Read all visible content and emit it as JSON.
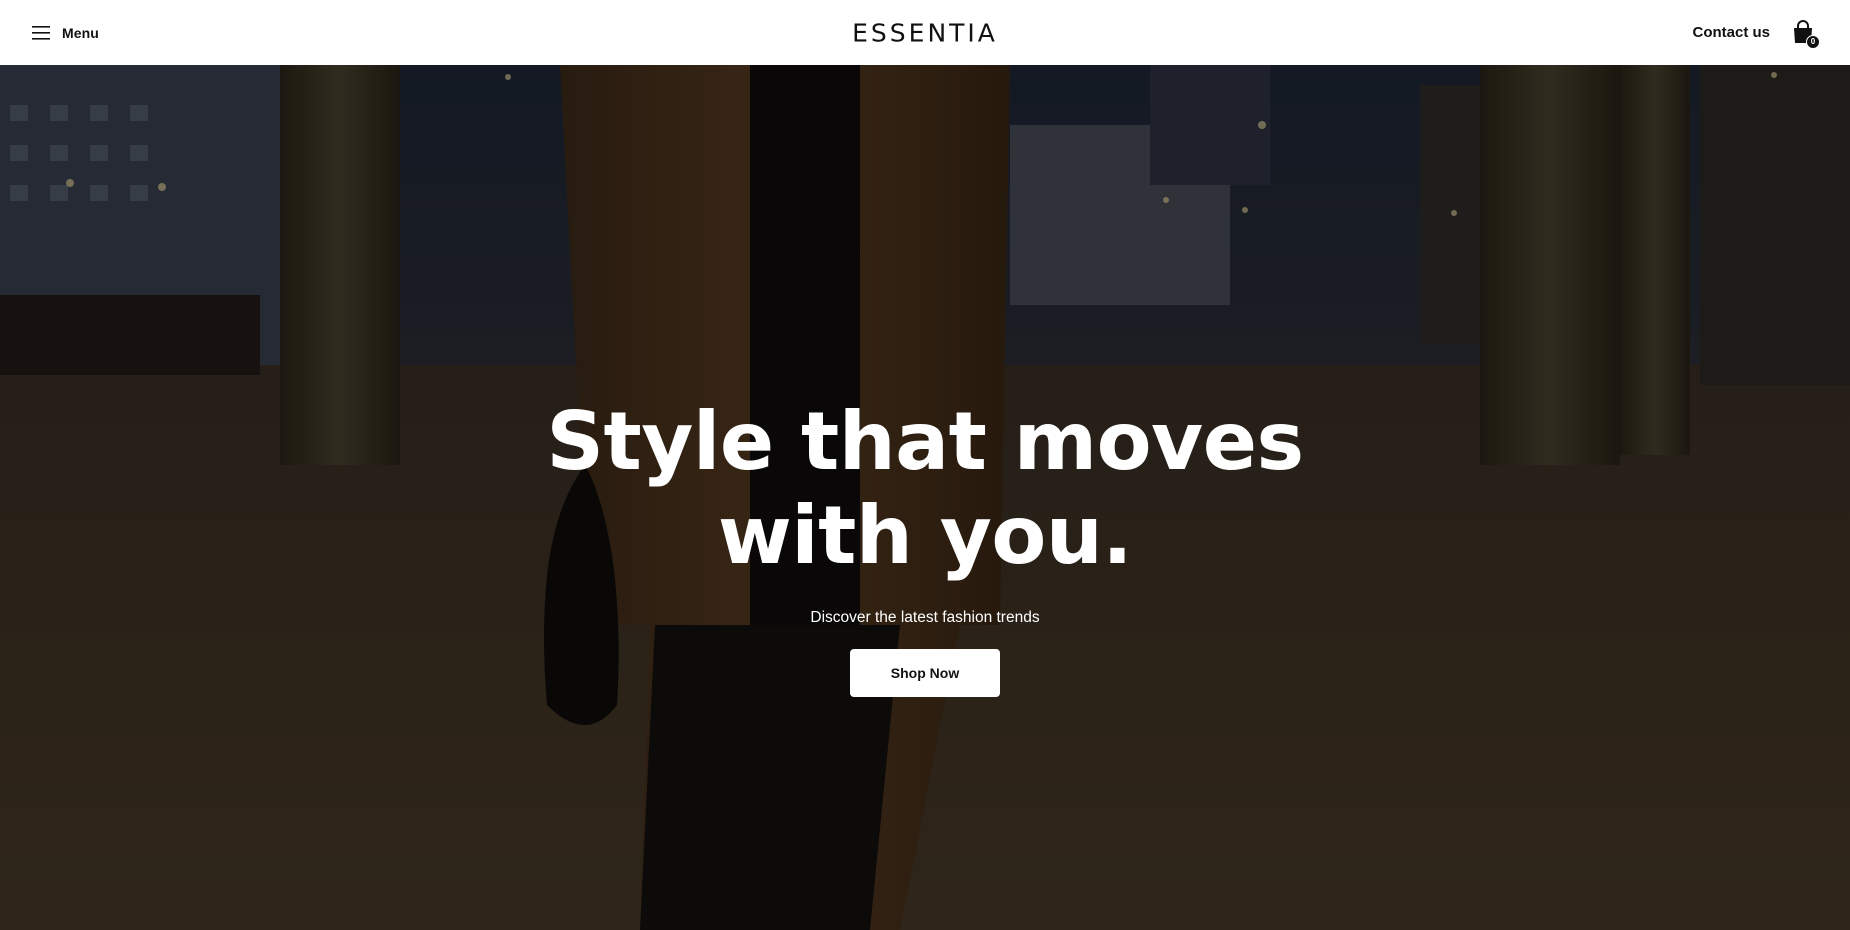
{
  "header": {
    "menu_label": "Menu",
    "logo": "ESSENTIA",
    "contact_label": "Contact us",
    "cart_count": "0"
  },
  "hero": {
    "title_line1": "Style that moves",
    "title_line2": "with you.",
    "subtitle": "Discover the latest fashion trends",
    "cta_label": "Shop Now"
  },
  "icons": {
    "menu": "hamburger-icon",
    "cart": "shopping-bag-icon"
  },
  "colors": {
    "header_bg": "#ffffff",
    "text_dark": "#111111",
    "hero_overlay": "#2a2218",
    "button_bg": "#ffffff"
  }
}
